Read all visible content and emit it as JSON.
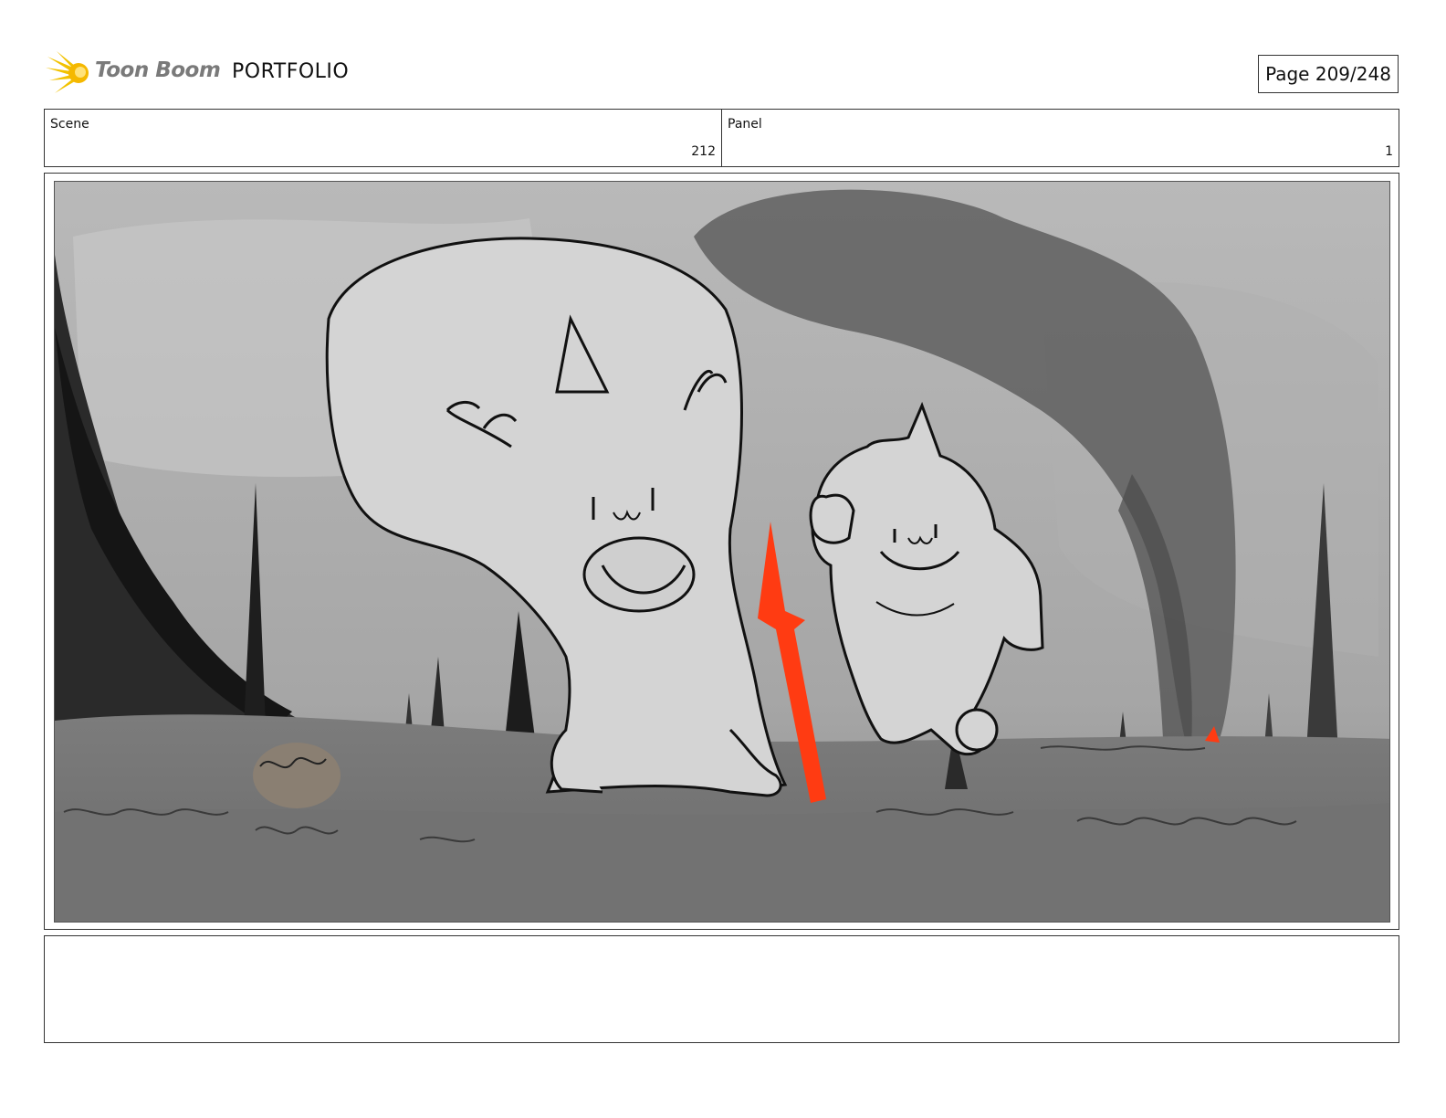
{
  "header": {
    "brand": "Toon Boom",
    "product": "PORTFOLIO",
    "page_indicator": "Page 209/248"
  },
  "info": {
    "scene_label": "Scene",
    "scene_value": "212",
    "panel_label": "Panel",
    "panel_value": "1"
  },
  "notes": {
    "text": ""
  },
  "colors": {
    "logo_yellow": "#f2c200",
    "brand_gray": "#7a7a7a",
    "arrow_red": "#ff3b12",
    "border": "#333333"
  },
  "icons": {
    "logo": "comet-burst-icon"
  }
}
